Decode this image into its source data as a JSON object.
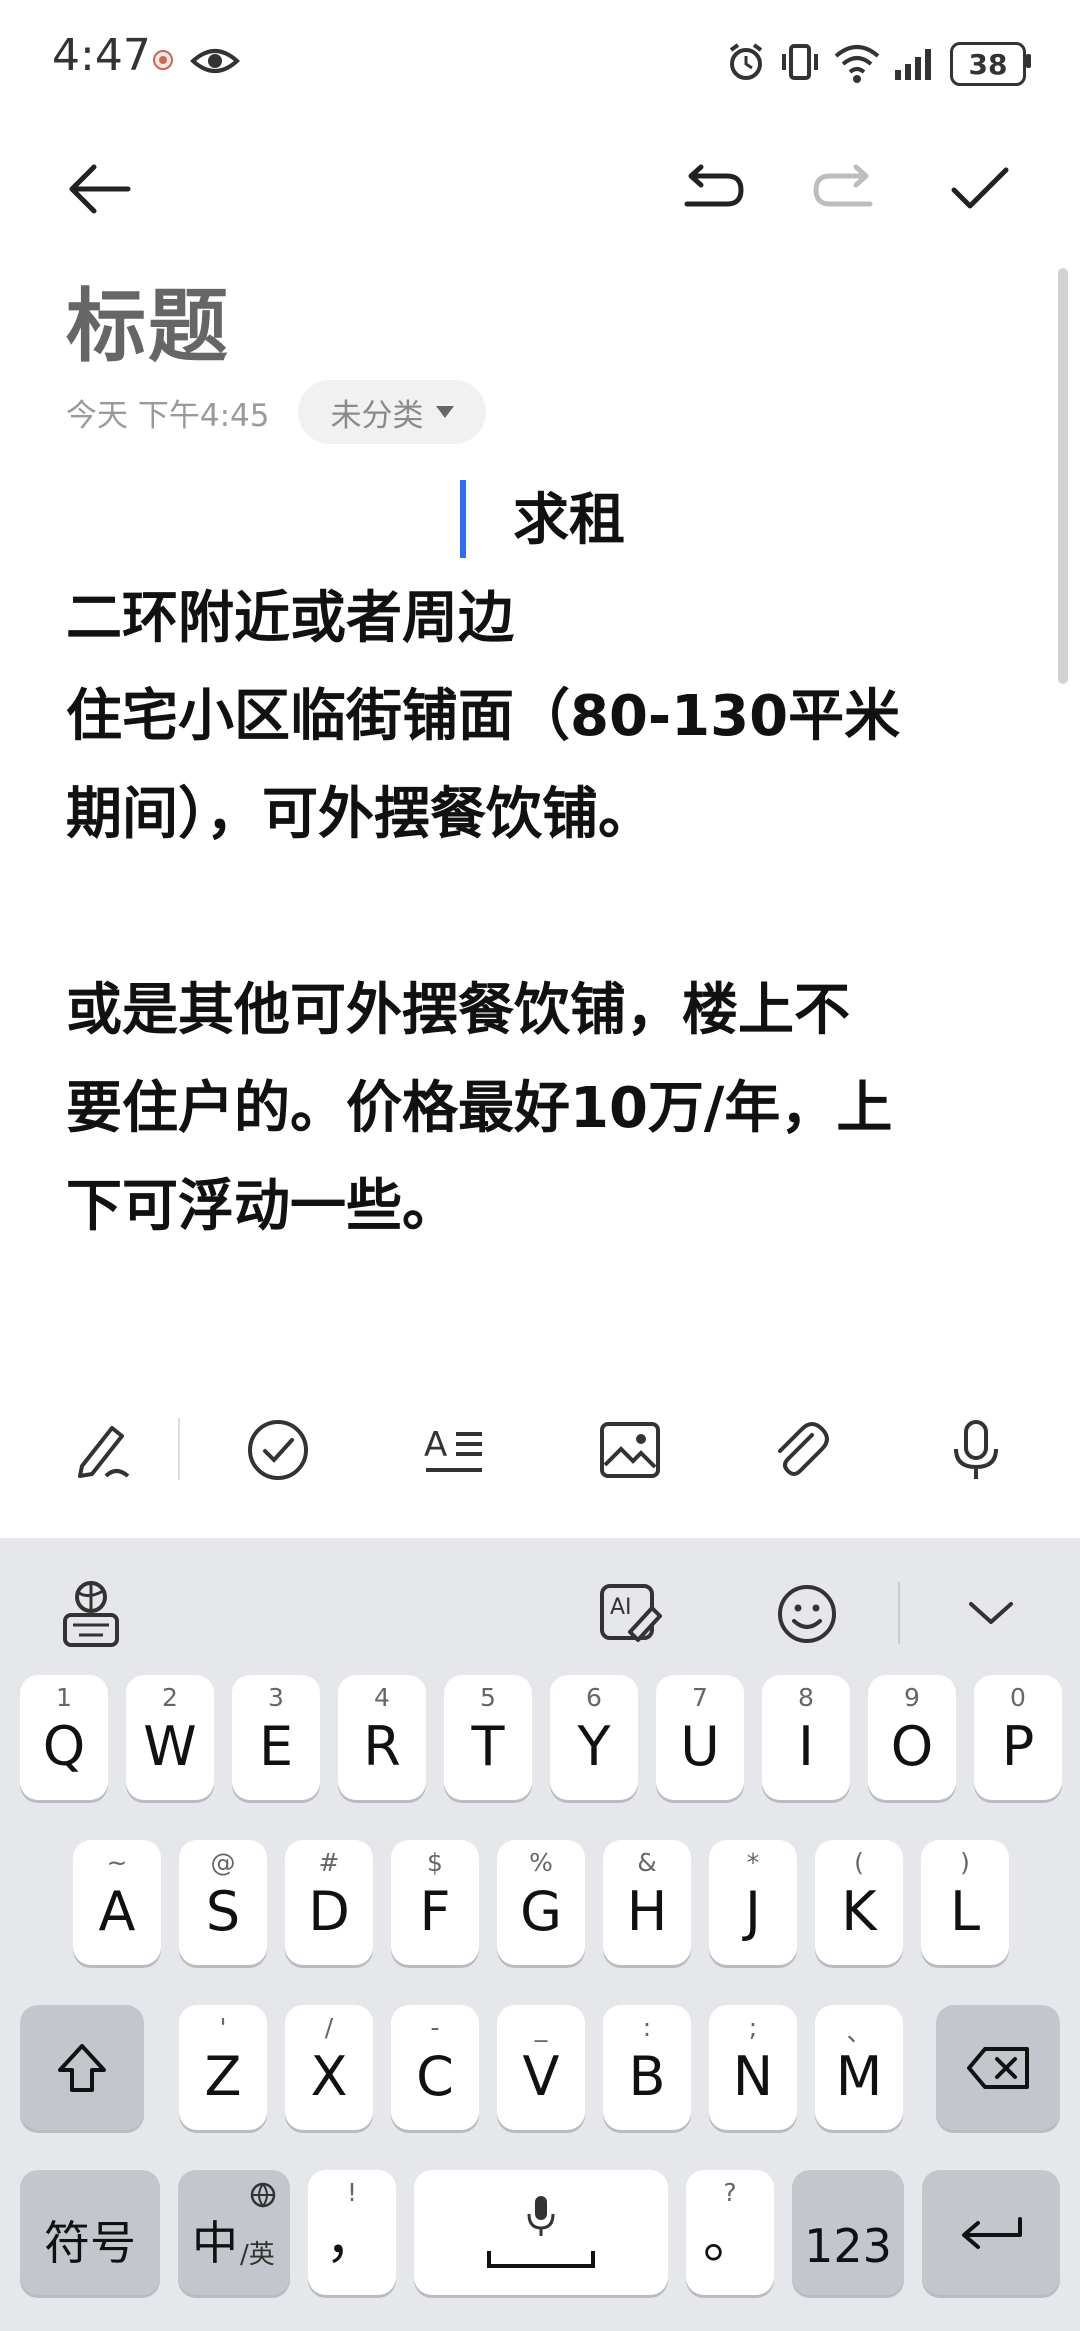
{
  "status_bar": {
    "time": "4:47",
    "battery": "38",
    "icons": [
      "app-notification-icon",
      "eye-icon",
      "alarm-icon",
      "vibrate-icon",
      "wifi-icon",
      "signal-icon",
      "battery-icon"
    ]
  },
  "toolbar": {
    "back_icon": "back-arrow-icon",
    "undo_icon": "undo-icon",
    "redo_icon": "redo-icon",
    "done_icon": "check-icon"
  },
  "note": {
    "title": "标题",
    "timestamp": "今天 下午4:45",
    "category": "未分类",
    "body_lines": [
      "求租",
      "二环附近或者周边",
      "住宅小区临街铺面（80-130平米",
      "期间），可外摆餐饮铺。",
      "",
      "或是其他可外摆餐饮铺，楼上不",
      "要住户的。价格最好10万/年，上",
      "下可浮动一些。"
    ]
  },
  "format_toolbar": {
    "items": [
      "handwriting-icon",
      "checklist-icon",
      "text-style-icon",
      "image-icon",
      "attachment-icon",
      "microphone-icon"
    ]
  },
  "keyboard": {
    "top_bar": [
      "keyboard-settings-icon",
      "ai-write-icon",
      "emoji-icon",
      "collapse-keyboard-icon"
    ],
    "row1": [
      {
        "main": "Q",
        "sub": "1"
      },
      {
        "main": "W",
        "sub": "2"
      },
      {
        "main": "E",
        "sub": "3"
      },
      {
        "main": "R",
        "sub": "4"
      },
      {
        "main": "T",
        "sub": "5"
      },
      {
        "main": "Y",
        "sub": "6"
      },
      {
        "main": "U",
        "sub": "7"
      },
      {
        "main": "I",
        "sub": "8"
      },
      {
        "main": "O",
        "sub": "9"
      },
      {
        "main": "P",
        "sub": "0"
      }
    ],
    "row2": [
      {
        "main": "A",
        "sub": "~"
      },
      {
        "main": "S",
        "sub": "@"
      },
      {
        "main": "D",
        "sub": "#"
      },
      {
        "main": "F",
        "sub": "$"
      },
      {
        "main": "G",
        "sub": "%"
      },
      {
        "main": "H",
        "sub": "&"
      },
      {
        "main": "J",
        "sub": "*"
      },
      {
        "main": "K",
        "sub": "("
      },
      {
        "main": "L",
        "sub": ")"
      }
    ],
    "row3": [
      {
        "main": "Z",
        "sub": "'"
      },
      {
        "main": "X",
        "sub": "/"
      },
      {
        "main": "C",
        "sub": "-"
      },
      {
        "main": "V",
        "sub": "_"
      },
      {
        "main": "B",
        "sub": ":"
      },
      {
        "main": "N",
        "sub": ";"
      },
      {
        "main": "M",
        "sub": "、"
      }
    ],
    "symbols_label": "符号",
    "lang_label_main": "中",
    "lang_label_sub": "/英",
    "comma_main": "，",
    "comma_sub": "!",
    "period_main": "。",
    "period_sub": "?",
    "numbers_label": "123"
  }
}
